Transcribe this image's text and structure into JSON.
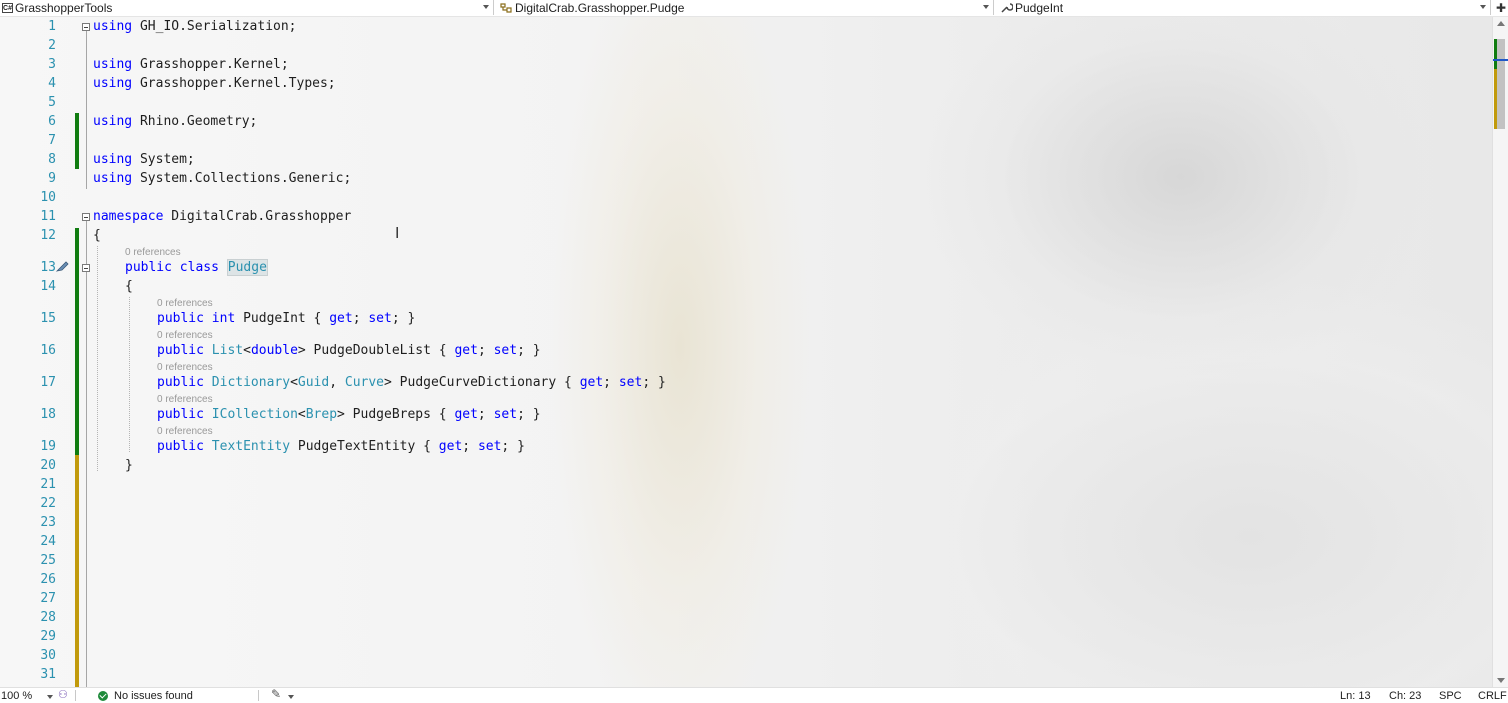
{
  "navbar": {
    "project": "GrasshopperTools",
    "type": "DigitalCrab.Grasshopper.Pudge",
    "member": "PudgeInt",
    "project_icon": "csharp-project-icon",
    "type_icon": "class-icon",
    "member_icon": "wrench-property-icon"
  },
  "editor": {
    "line_numbers": [
      "1",
      "2",
      "3",
      "4",
      "5",
      "6",
      "7",
      "8",
      "9",
      "10",
      "11",
      "12",
      "13",
      "14",
      "15",
      "16",
      "17",
      "18",
      "19",
      "20",
      "21",
      "22",
      "23",
      "24",
      "25",
      "26",
      "27",
      "28",
      "29",
      "30",
      "31"
    ],
    "codelens": "0 references",
    "colors": {
      "keyword": "#0000ff",
      "type": "#2b91af",
      "line_number": "#2b91af",
      "changed_saved": "#107c10",
      "changed_unsaved": "#c19a0c"
    }
  },
  "code": {
    "l1_kw": "using",
    "l1_rest": " GH_IO.Serialization;",
    "l3_kw": "using",
    "l3_rest": " Grasshopper.Kernel;",
    "l4_kw": "using",
    "l4_rest": " Grasshopper.Kernel.Types;",
    "l6_kw": "using",
    "l6_rest": " Rhino.Geometry;",
    "l8_kw": "using",
    "l8_rest": " System;",
    "l9_kw": "using",
    "l9_rest": " System.Collections.Generic;",
    "l11_kw": "namespace",
    "l11_rest": " DigitalCrab.Grasshopper",
    "l12": "{",
    "l13_kw1": "public",
    "l13_kw2": "class",
    "l13_name": "Pudge",
    "l14": "{",
    "l15_kw1": "public",
    "l15_type": "int",
    "l15_name": " PudgeInt { ",
    "l15_get": "get",
    "l15_mid": "; ",
    "l15_set": "set",
    "l15_end": "; }",
    "l16_kw1": "public",
    "l16_type": "List",
    "l16_lt": "<",
    "l16_arg": "double",
    "l16_name": "> PudgeDoubleList { ",
    "l16_get": "get",
    "l16_mid": "; ",
    "l16_set": "set",
    "l16_end": "; }",
    "l17_kw1": "public",
    "l17_type": "Dictionary",
    "l17_lt": "<",
    "l17_arg1": "Guid",
    "l17_comma": ", ",
    "l17_arg2": "Curve",
    "l17_name": "> PudgeCurveDictionary { ",
    "l17_get": "get",
    "l17_mid": "; ",
    "l17_set": "set",
    "l17_end": "; }",
    "l18_kw1": "public",
    "l18_type": "ICollection",
    "l18_lt": "<",
    "l18_arg": "Brep",
    "l18_name": "> PudgeBreps { ",
    "l18_get": "get",
    "l18_mid": "; ",
    "l18_set": "set",
    "l18_end": "; }",
    "l19_kw1": "public",
    "l19_type": "TextEntity",
    "l19_name": " PudgeTextEntity { ",
    "l19_get": "get",
    "l19_mid": "; ",
    "l19_set": "set",
    "l19_end": "; }",
    "l20": "}"
  },
  "statusbar": {
    "zoom": "100 %",
    "issues": "No issues found",
    "line": "Ln: 13",
    "char": "Ch: 23",
    "whitespace": "SPC",
    "line_ending": "CRLF"
  }
}
